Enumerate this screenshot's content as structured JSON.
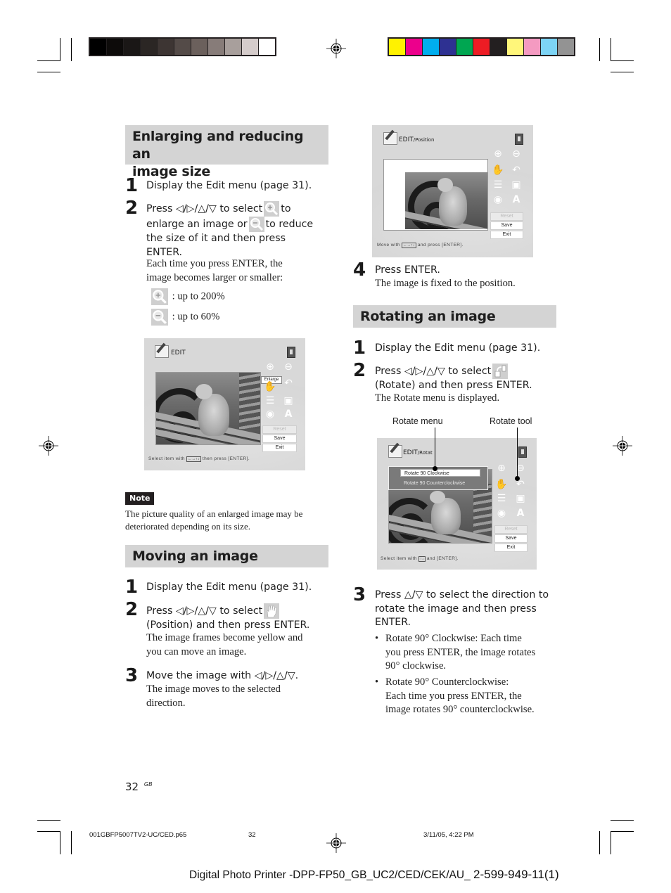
{
  "print_marks": {
    "grayscale_swatches": [
      "#000000",
      "#0d0b0a",
      "#1a1716",
      "#2b2624",
      "#3d3533",
      "#544b48",
      "#6b605c",
      "#877c79",
      "#a89f9c",
      "#d5cccb",
      "#ffffff"
    ],
    "color_swatches": [
      "#fff200",
      "#ec008c",
      "#00aeef",
      "#2e3192",
      "#00a651",
      "#ed1c24",
      "#231f20",
      "#fff67a",
      "#f49ac1",
      "#7dd4f5",
      "#939393"
    ]
  },
  "sections": {
    "enlarge": {
      "title_line1": "Enlarging and reducing an",
      "title_line2": "image size",
      "step1": {
        "num": "1",
        "text": "Display the Edit menu (page 31)."
      },
      "step2": {
        "num": "2",
        "line1_a": "Press ◁/▷/△/▽ to select",
        "line1_b": "to",
        "line2_a": "enlarge an image or",
        "line2_b": "to reduce",
        "line3": "the size of it and then press",
        "line4": "ENTER.",
        "sub1": "Each time you press ENTER, the",
        "sub2": "image becomes larger or smaller:",
        "zoom_in": ":  up to 200%",
        "zoom_out": ":  up to 60%"
      }
    },
    "note": {
      "badge": "Note",
      "line1": "The picture quality of an enlarged image may be",
      "line2": "deteriorated depending on its size."
    },
    "moving": {
      "title": "Moving an image",
      "step1": {
        "num": "1",
        "text": "Display the Edit menu (page 31)."
      },
      "step2": {
        "num": "2",
        "line1": "Press ◁/▷/△/▽ to select",
        "line2": "(Position) and then press ENTER.",
        "sub1": "The image frames become yellow and",
        "sub2": "you can move an image."
      },
      "step3": {
        "num": "3",
        "line1": "Move the image with ◁/▷/△/▽.",
        "sub1": "The image moves to the selected",
        "sub2": "direction."
      },
      "step4": {
        "num": "4",
        "line1": "Press ENTER.",
        "sub1": "The image is fixed to the position."
      }
    },
    "rotating": {
      "title": "Rotating an image",
      "step1": {
        "num": "1",
        "text": "Display the Edit menu (page 31)."
      },
      "step2": {
        "num": "2",
        "line1": "Press ◁/▷/△/▽ to select",
        "line2": "(Rotate) and then press ENTER.",
        "sub1": "The Rotate menu is displayed."
      },
      "callouts": {
        "menu": "Rotate menu",
        "tool": "Rotate tool"
      },
      "step3": {
        "num": "3",
        "line1": "Press △/▽ to select the direction to",
        "line2": "rotate the image and then press",
        "line3": "ENTER.",
        "bullet1_l1": "Rotate 90° Clockwise:  Each time",
        "bullet1_l2": "you press ENTER, the image rotates",
        "bullet1_l3": "90° clockwise.",
        "bullet2_l1": "Rotate 90° Counterclockwise:",
        "bullet2_l2": "Each time you press ENTER, the",
        "bullet2_l3": "image rotates 90° counterclockwise."
      }
    }
  },
  "screens": {
    "edit": {
      "title": "EDIT",
      "tooltip": "Enlarge",
      "buttons": [
        "Reset",
        "Save",
        "Exit"
      ],
      "hint_a": "Select  item  with",
      "hint_keys": "←→↑↓",
      "hint_b": "then  press  [ENTER]."
    },
    "position": {
      "title": "EDIT",
      "subtitle": "/Position",
      "buttons": [
        "Reset",
        "Save",
        "Exit"
      ],
      "hint_a": "Move  with",
      "hint_keys": "←→↑↓",
      "hint_b": "and  press  [ENTER]."
    },
    "rotate": {
      "title": "EDIT",
      "subtitle": "/Rotat",
      "menu_items": [
        "Rotate  90  Clockwise",
        "Rotate  90  Counterclockwise"
      ],
      "buttons": [
        "Reset",
        "Save",
        "Exit"
      ],
      "hint_a": "Select  item  with",
      "hint_keys": "↑↓",
      "hint_b": "and  [ENTER]."
    }
  },
  "footer": {
    "page_number": "32",
    "page_lang": "GB",
    "file_name": "001GBFP5007TV2-UC/CED.p65",
    "file_page": "32",
    "timestamp": "3/11/05, 4:22 PM",
    "product_line": "Digital Photo Printer -DPP-FP50_GB_UC2/CED/CEK/AU_",
    "part_number": "2-599-949-11(1)"
  }
}
